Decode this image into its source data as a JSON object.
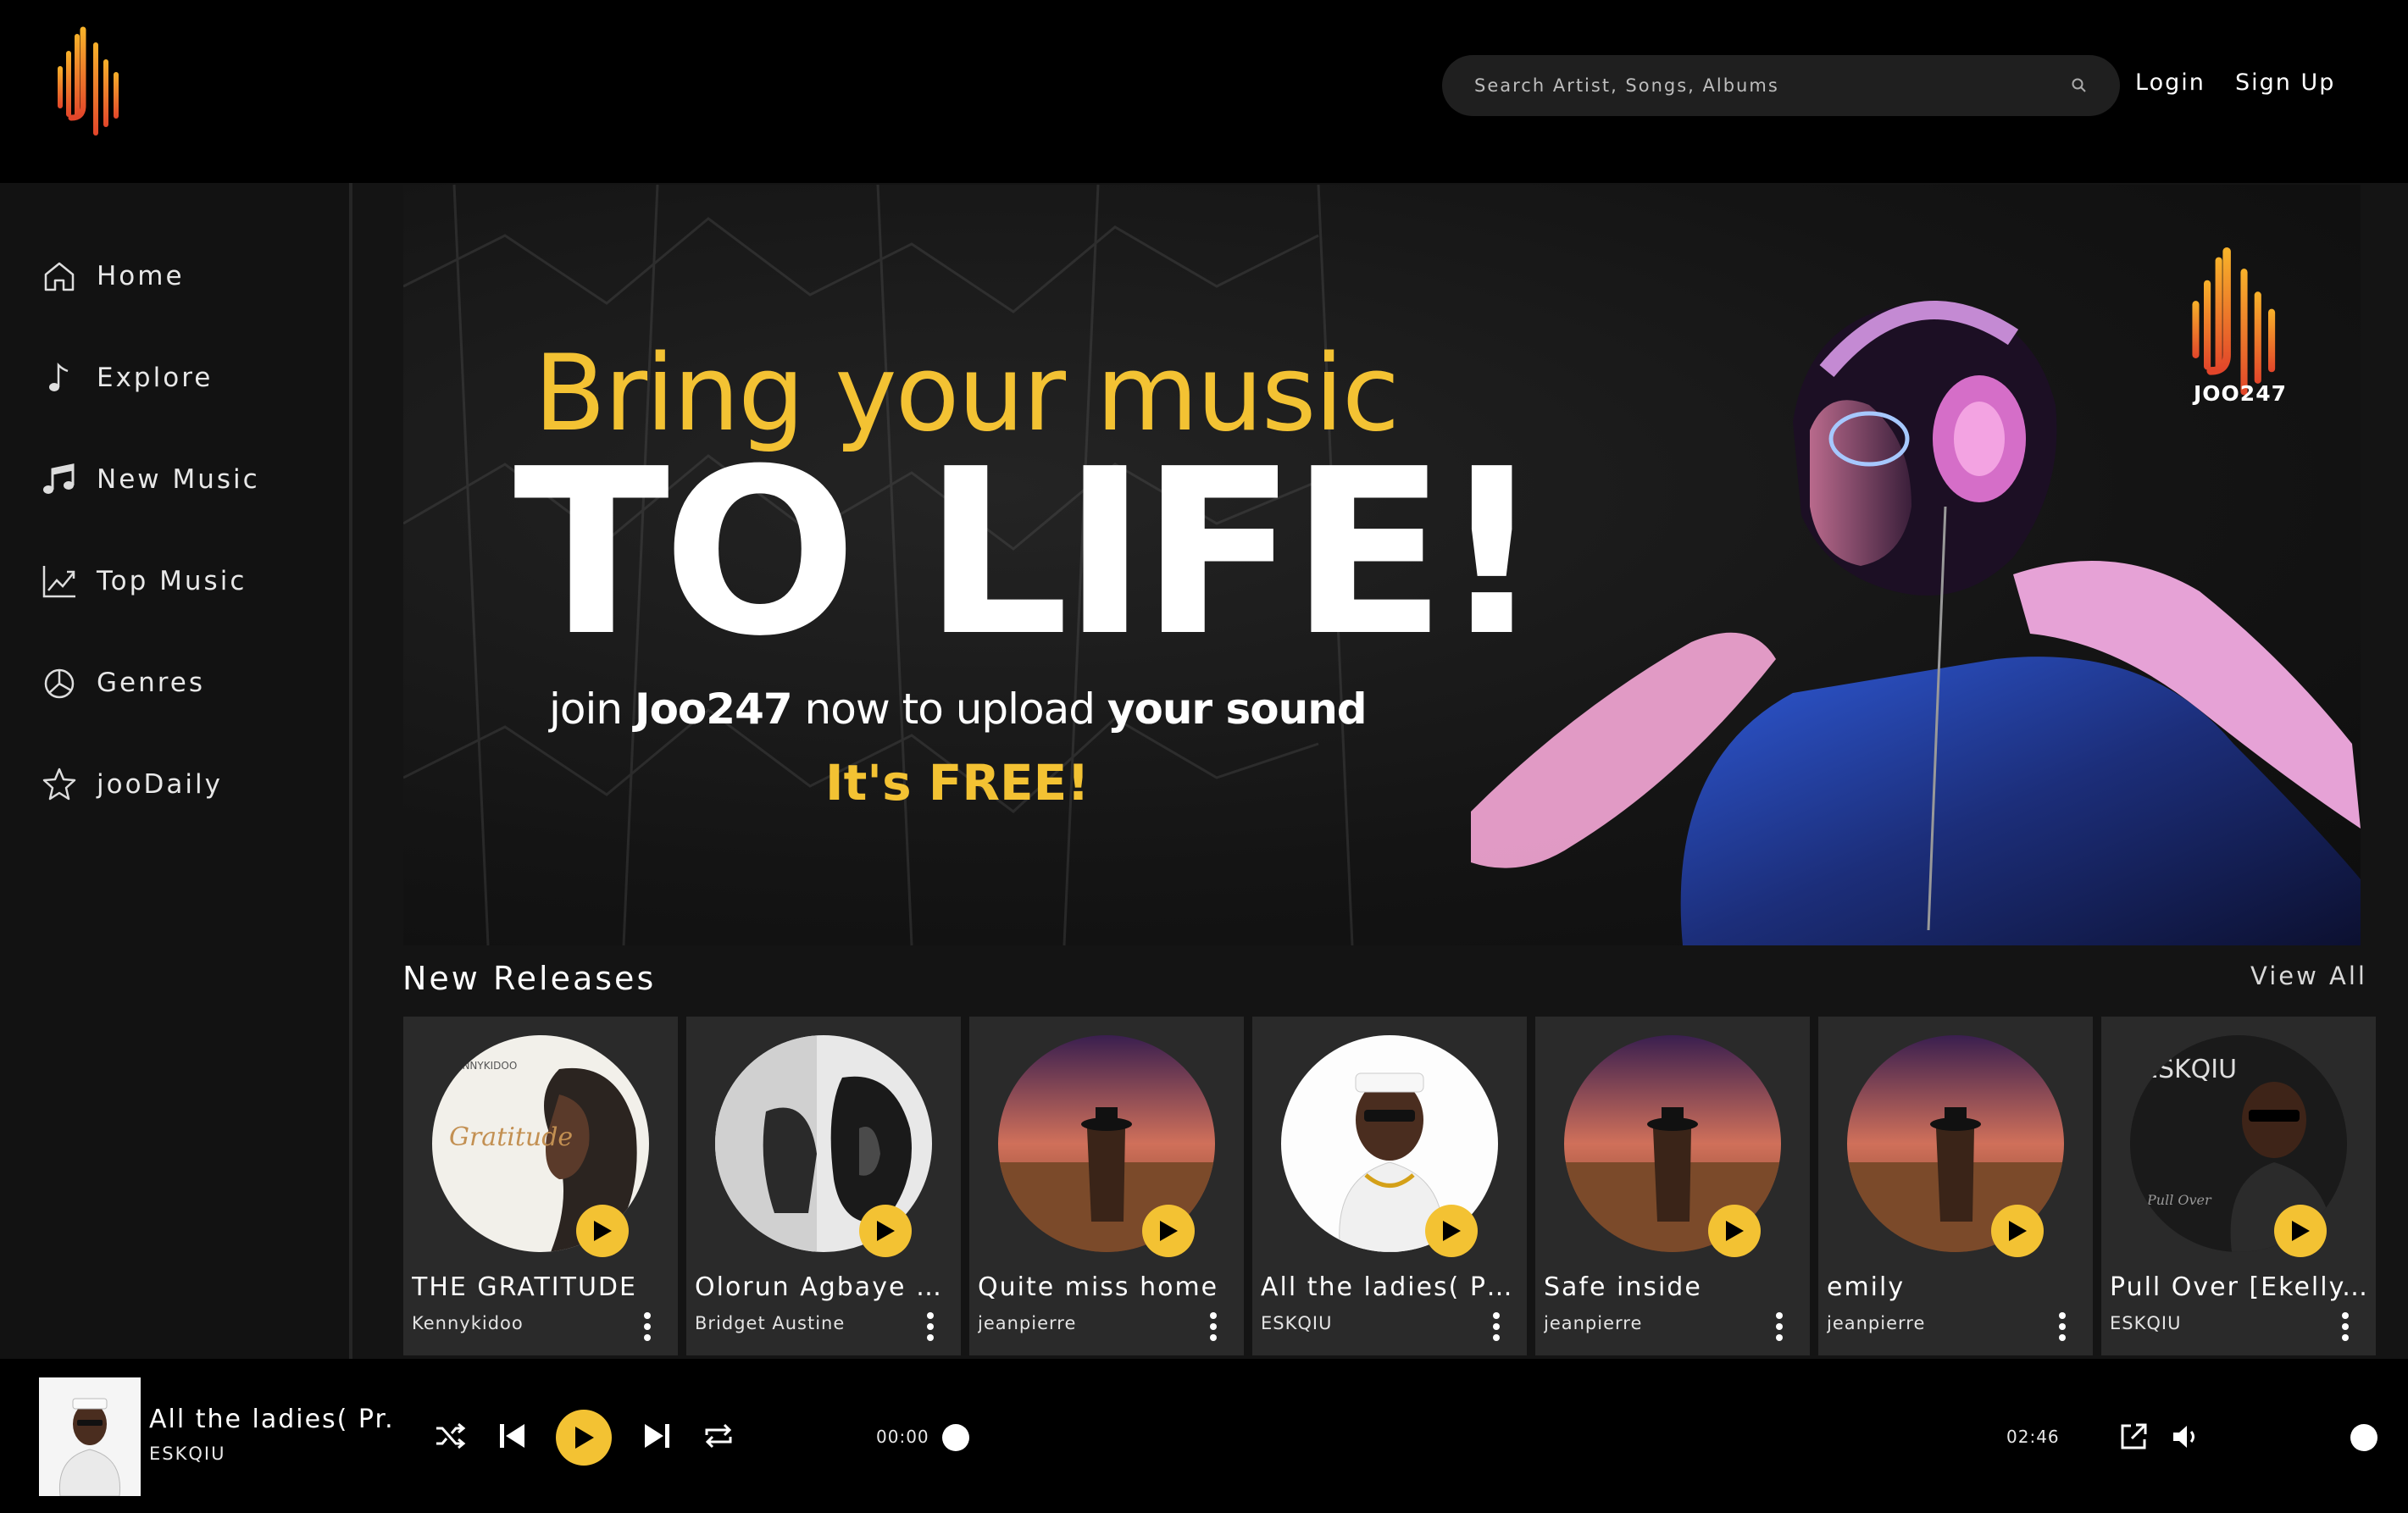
{
  "header": {
    "search_placeholder": "Search Artist, Songs, Albums",
    "login_label": "Login",
    "signup_label": "Sign Up"
  },
  "sidebar": {
    "items": [
      {
        "label": "Home",
        "icon": "home-icon"
      },
      {
        "label": "Explore",
        "icon": "music-note-icon"
      },
      {
        "label": "New Music",
        "icon": "music-notes-icon"
      },
      {
        "label": "Top Music",
        "icon": "trending-chart-icon"
      },
      {
        "label": "Genres",
        "icon": "genres-icon"
      },
      {
        "label": "jooDaily",
        "icon": "star-icon"
      }
    ]
  },
  "banner": {
    "line1": "Bring your music",
    "line2": "TO LIFE!",
    "line3_a": "join ",
    "line3_b": "Joo247",
    "line3_c": " now to upload ",
    "line3_d": "your sound",
    "line4": "It's FREE!",
    "logo_text": "JOO247"
  },
  "releases": {
    "title": "New Releases",
    "view_all": "View All",
    "items": [
      {
        "title": "THE GRATITUDE",
        "artist": "Kennykidoo",
        "cover": "gratitude"
      },
      {
        "title": "Olorun Agbaye C...",
        "artist": "Bridget Austine",
        "cover": "bw"
      },
      {
        "title": "Quite miss home",
        "artist": "jeanpierre",
        "cover": "field"
      },
      {
        "title": "All the ladies( Pr...",
        "artist": "ESKQIU",
        "cover": "white"
      },
      {
        "title": "Safe inside",
        "artist": "jeanpierre",
        "cover": "field"
      },
      {
        "title": "emily",
        "artist": "jeanpierre",
        "cover": "field"
      },
      {
        "title": "Pull Over [Ekelly...",
        "artist": "ESKQIU",
        "cover": "dark"
      }
    ]
  },
  "player": {
    "title": "All the ladies( Pr...",
    "artist": "ESKQIU",
    "current_time": "00:00",
    "duration": "02:46",
    "progress": 0,
    "volume": 1.0
  },
  "colors": {
    "accent": "#f3c233",
    "background": "#000000",
    "panel": "#121212",
    "card": "#2a2a2a"
  }
}
